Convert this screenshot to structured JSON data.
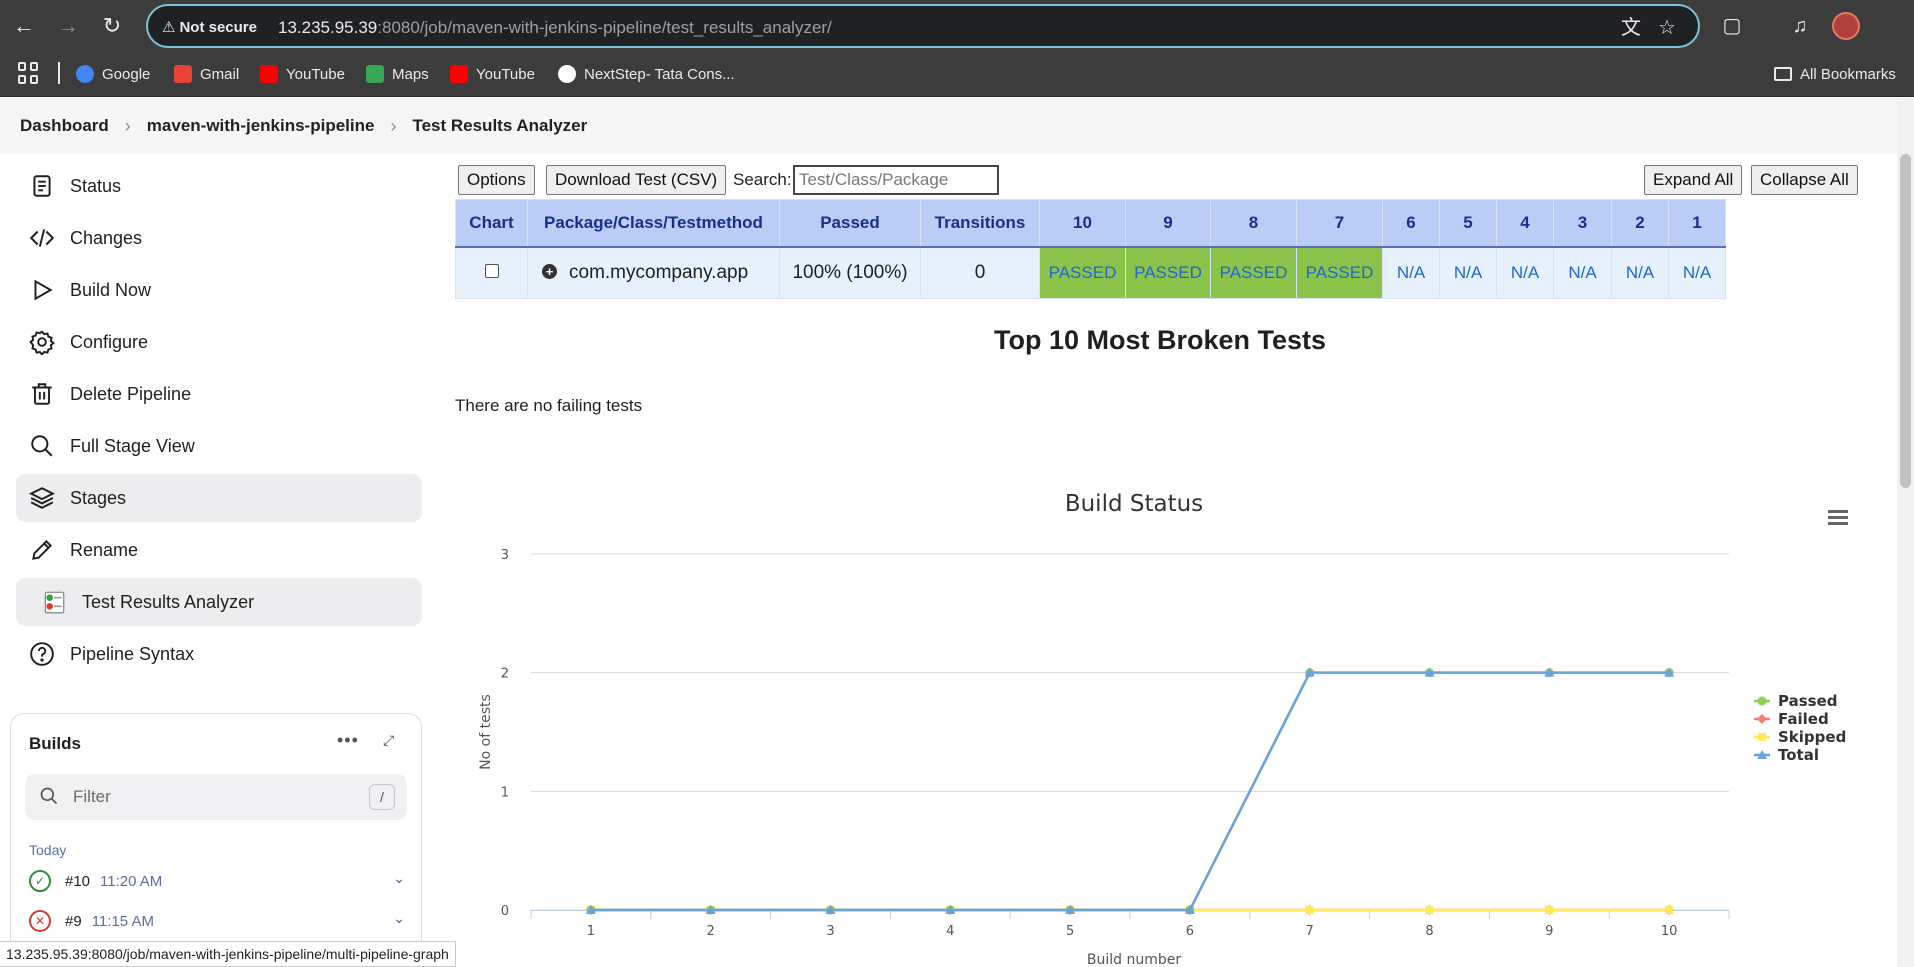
{
  "browser": {
    "security_label": "Not secure",
    "url_host": "13.235.95.39",
    "url_rest": ":8080/job/maven-with-jenkins-pipeline/test_results_analyzer/",
    "status_url": "13.235.95.39:8080/job/maven-with-jenkins-pipeline/multi-pipeline-graph",
    "bookmarks": [
      {
        "label": "Google",
        "icon": "google-icon",
        "color": "#4285f4"
      },
      {
        "label": "Gmail",
        "icon": "gmail-icon",
        "color": "#ea4335"
      },
      {
        "label": "YouTube",
        "icon": "youtube-icon",
        "color": "#ff0000"
      },
      {
        "label": "Maps",
        "icon": "maps-icon",
        "color": "#34a853"
      },
      {
        "label": "YouTube",
        "icon": "youtube-icon",
        "color": "#ff0000"
      },
      {
        "label": "NextStep- Tata Cons...",
        "icon": "tcs-icon",
        "color": "#ffffff"
      }
    ],
    "all_bookmarks": "All Bookmarks"
  },
  "breadcrumb": {
    "items": [
      "Dashboard",
      "maven-with-jenkins-pipeline",
      "Test Results Analyzer"
    ]
  },
  "sidebar": {
    "items": [
      {
        "label": "Status",
        "icon": "document-icon"
      },
      {
        "label": "Changes",
        "icon": "code-icon"
      },
      {
        "label": "Build Now",
        "icon": "play-icon"
      },
      {
        "label": "Configure",
        "icon": "gear-icon"
      },
      {
        "label": "Delete Pipeline",
        "icon": "trash-icon"
      },
      {
        "label": "Full Stage View",
        "icon": "search-icon"
      },
      {
        "label": "Stages",
        "icon": "layers-icon"
      },
      {
        "label": "Rename",
        "icon": "pencil-icon"
      },
      {
        "label": "Test Results Analyzer",
        "icon": "test-results-icon"
      },
      {
        "label": "Pipeline Syntax",
        "icon": "help-icon"
      }
    ],
    "builds": {
      "title": "Builds",
      "filter_placeholder": "Filter",
      "filter_shortcut": "/",
      "group_label": "Today",
      "rows": [
        {
          "number": "#10",
          "time": "11:20 AM",
          "status": "success"
        },
        {
          "number": "#9",
          "time": "11:15 AM",
          "status": "failed"
        }
      ]
    }
  },
  "toolbar": {
    "options_label": "Options",
    "download_label": "Download Test (CSV)",
    "search_label": "Search:",
    "search_placeholder": "Test/Class/Package",
    "expand_label": "Expand All",
    "collapse_label": "Collapse All"
  },
  "results_table": {
    "headers": [
      "Chart",
      "Package/Class/Testmethod",
      "Passed",
      "Transitions",
      "10",
      "9",
      "8",
      "7",
      "6",
      "5",
      "4",
      "3",
      "2",
      "1"
    ],
    "row": {
      "package": "com.mycompany.app",
      "passed": "100% (100%)",
      "transitions": "0",
      "builds": [
        "PASSED",
        "PASSED",
        "PASSED",
        "PASSED",
        "N/A",
        "N/A",
        "N/A",
        "N/A",
        "N/A",
        "N/A"
      ]
    }
  },
  "broken": {
    "title": "Top 10 Most Broken Tests",
    "message": "There are no failing tests"
  },
  "chart_data": {
    "type": "line",
    "title": "Build Status",
    "xlabel": "Build number",
    "ylabel": "No of tests",
    "x": [
      1,
      2,
      3,
      4,
      5,
      6,
      7,
      8,
      9,
      10
    ],
    "ylim": [
      0,
      3
    ],
    "yticks": [
      0,
      1,
      2,
      3
    ],
    "grid": true,
    "legend_position": "right",
    "series": [
      {
        "name": "Passed",
        "color": "#8bd04e",
        "marker": "circle",
        "values": [
          0,
          0,
          0,
          0,
          0,
          0,
          2,
          2,
          2,
          2
        ]
      },
      {
        "name": "Failed",
        "color": "#f27d7d",
        "marker": "diamond",
        "values": [
          0,
          0,
          0,
          0,
          0,
          0,
          0,
          0,
          0,
          0
        ]
      },
      {
        "name": "Skipped",
        "color": "#ffea5a",
        "marker": "square",
        "values": [
          0,
          0,
          0,
          0,
          0,
          0,
          0,
          0,
          0,
          0
        ]
      },
      {
        "name": "Total",
        "color": "#6aa2e0",
        "marker": "triangle",
        "values": [
          0,
          0,
          0,
          0,
          0,
          0,
          2,
          2,
          2,
          2
        ]
      }
    ]
  }
}
